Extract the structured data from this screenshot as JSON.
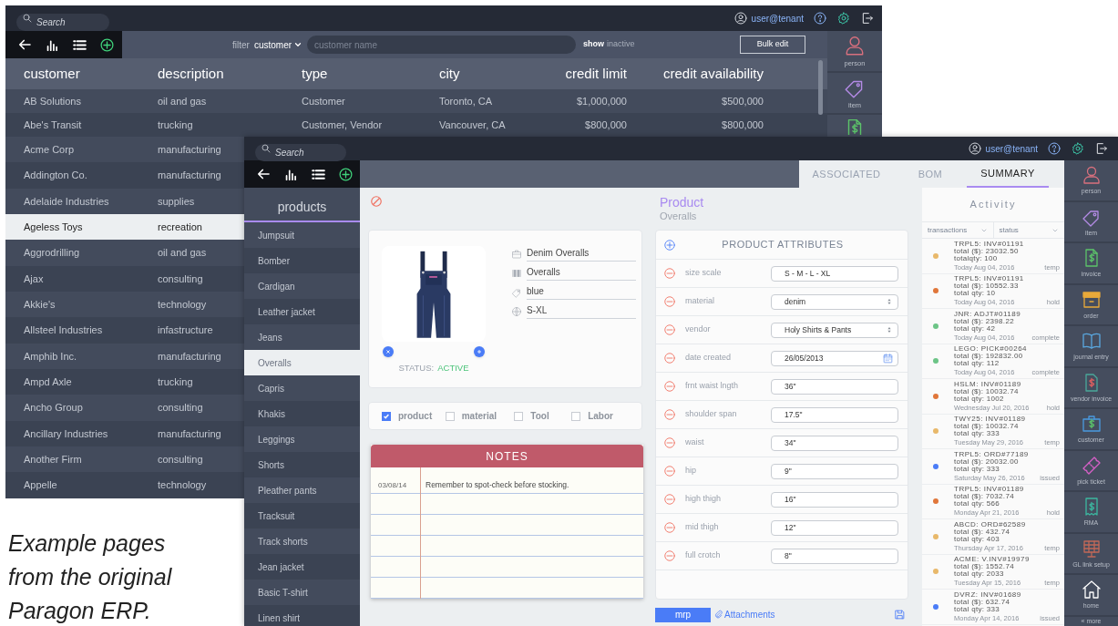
{
  "back_window": {
    "search": {
      "placeholder": "Search"
    },
    "user": "user@tenant",
    "filter": {
      "label": "filter",
      "value": "customer",
      "placeholder": "customer name"
    },
    "show_toggle": {
      "label": "show",
      "value": "inactive"
    },
    "bulk_button": "Bulk edit",
    "table": {
      "columns": [
        "customer",
        "description",
        "type",
        "city",
        "credit limit",
        "credit availability"
      ],
      "rows": [
        {
          "cells": [
            "AB Solutions",
            "oil and gas",
            "Customer",
            "Toronto, CA",
            "$1,000,000",
            "$500,000"
          ],
          "selected": false
        },
        {
          "cells": [
            "Abe's Transit",
            "trucking",
            "Customer, Vendor",
            "Vancouver, CA",
            "$800,000",
            "$800,000"
          ],
          "selected": false
        },
        {
          "cells": [
            "Acme Corp",
            "manufacturing"
          ],
          "selected": false
        },
        {
          "cells": [
            "Addington Co.",
            "manufacturing"
          ],
          "selected": false
        },
        {
          "cells": [
            "Adelaide Industries",
            "supplies"
          ],
          "selected": false
        },
        {
          "cells": [
            "Ageless Toys",
            "recreation"
          ],
          "selected": true
        },
        {
          "cells": [
            "Aggrodrilling",
            "oil and gas"
          ],
          "selected": false
        },
        {
          "cells": [
            "Ajax",
            "consulting"
          ],
          "selected": false
        },
        {
          "cells": [
            "Akkie's",
            "technology"
          ],
          "selected": false
        },
        {
          "cells": [
            "Allsteel Industries",
            "infastructure"
          ],
          "selected": false
        },
        {
          "cells": [
            "Amphib Inc.",
            "manufacturing"
          ],
          "selected": false
        },
        {
          "cells": [
            "Ampd Axle",
            "trucking"
          ],
          "selected": false
        },
        {
          "cells": [
            "Ancho Group",
            "consulting"
          ],
          "selected": false
        },
        {
          "cells": [
            "Ancillary Industries",
            "manufacturing"
          ],
          "selected": false
        },
        {
          "cells": [
            "Another Firm",
            "consulting"
          ],
          "selected": false
        },
        {
          "cells": [
            "Appelle",
            "technology"
          ],
          "selected": false
        }
      ]
    },
    "sidebar": {
      "items": [
        {
          "label": "person"
        },
        {
          "label": "item"
        }
      ]
    }
  },
  "caption": "Example pages from the original Paragon ERP.",
  "front_window": {
    "search": {
      "placeholder": "Search"
    },
    "user": "user@tenant",
    "tabs": [
      {
        "label": "ASSOCIATED",
        "selected": false
      },
      {
        "label": "BOM",
        "selected": false
      },
      {
        "label": "SUMMARY",
        "selected": true
      }
    ],
    "list": {
      "title": "products",
      "items": [
        {
          "label": "Jumpsuit",
          "selected": false
        },
        {
          "label": "Bomber",
          "selected": false
        },
        {
          "label": "Cardigan",
          "selected": false
        },
        {
          "label": "Leather jacket",
          "selected": false
        },
        {
          "label": "Jeans",
          "selected": false
        },
        {
          "label": "Overalls",
          "selected": true
        },
        {
          "label": "Capris",
          "selected": false
        },
        {
          "label": "Khakis",
          "selected": false
        },
        {
          "label": "Leggings",
          "selected": false
        },
        {
          "label": "Shorts",
          "selected": false
        },
        {
          "label": "Pleather pants",
          "selected": false
        },
        {
          "label": "Tracksuit",
          "selected": false
        },
        {
          "label": "Track shorts",
          "selected": false
        },
        {
          "label": "Jean jacket",
          "selected": false
        },
        {
          "label": "Basic T-shirt",
          "selected": false
        },
        {
          "label": "Linen shirt",
          "selected": false
        }
      ]
    },
    "product_card": {
      "fields": [
        "Denim Overalls",
        "Overalls",
        "blue",
        "S-XL"
      ],
      "status_label": "STATUS:",
      "status": "ACTIVE"
    },
    "types": [
      {
        "label": "product",
        "checked": true
      },
      {
        "label": "material",
        "checked": false
      },
      {
        "label": "Tool",
        "checked": false
      },
      {
        "label": "Labor",
        "checked": false
      }
    ],
    "notes": {
      "title": "NOTES",
      "entries": [
        {
          "date": "03/08/14",
          "text": "Remember to spot-check before stocking."
        }
      ]
    },
    "product": {
      "title": "Product",
      "subtitle": "Overalls"
    },
    "attributes": {
      "title": "PRODUCT ATTRIBUTES",
      "rows": [
        {
          "label": "size scale",
          "value": "S - M - L - XL",
          "kind": "text"
        },
        {
          "label": "material",
          "value": "denim",
          "kind": "select"
        },
        {
          "label": "vendor",
          "value": "Holy Shirts & Pants",
          "kind": "select"
        },
        {
          "label": "date created",
          "value": "26/05/2013",
          "kind": "date"
        },
        {
          "label": "frnt waist lngth",
          "value": "36\"",
          "kind": "text"
        },
        {
          "label": "shoulder span",
          "value": "17.5\"",
          "kind": "text"
        },
        {
          "label": "waist",
          "value": "34\"",
          "kind": "text"
        },
        {
          "label": "hip",
          "value": "9\"",
          "kind": "text"
        },
        {
          "label": "high thigh",
          "value": "16\"",
          "kind": "text"
        },
        {
          "label": "mid thigh",
          "value": "12\"",
          "kind": "text"
        },
        {
          "label": "full crotch",
          "value": "8\"",
          "kind": "text"
        }
      ]
    },
    "footer": {
      "mrp_button": "mrp",
      "attachments_link": "Attachments"
    },
    "activity": {
      "title": "Activity",
      "filters": [
        "transactions",
        "status"
      ],
      "entries": [
        {
          "ref": "TRPL5: INV#01191",
          "total": "total ($): 23032.50",
          "qty": "totalqty: 100",
          "date": "Today Aug 04, 2016",
          "status": "temp",
          "color": "#e8b86a"
        },
        {
          "ref": "TRPL5: INV#01191",
          "total": "total ($): 10552.33",
          "qty": "total qty: 10",
          "date": "Today Aug 04, 2016",
          "status": "hold",
          "color": "#e0763a"
        },
        {
          "ref": "JNR: ADJT#01189",
          "total": "total ($): 2398.22",
          "qty": "total qty: 42",
          "date": "Today Aug 04, 2016",
          "status": "complete",
          "color": "#6cc486"
        },
        {
          "ref": "LEGO: PICK#00264",
          "total": "total ($): 192832.00",
          "qty": "total qty: 112",
          "date": "Today Aug 04, 2016",
          "status": "complete",
          "color": "#6cc486"
        },
        {
          "ref": "HSLM: INV#01189",
          "total": "total ($): 10032.74",
          "qty": "total qty: 1002",
          "date": "Wednesday Jul 20, 2016",
          "status": "hold",
          "color": "#e0763a"
        },
        {
          "ref": "TWY25: INV#01189",
          "total": "total ($): 10032.74",
          "qty": "total qty: 333",
          "date": "Tuesday May 29, 2016",
          "status": "temp",
          "color": "#e8b86a"
        },
        {
          "ref": "TRPL5: ORD#77189",
          "total": "total ($): 20032.00",
          "qty": "total qty: 333",
          "date": "Saturday May 26, 2016",
          "status": "issued",
          "color": "#4a7cf7"
        },
        {
          "ref": "TRPL5: INV#01189",
          "total": "total ($): 7032.74",
          "qty": "total qty: 566",
          "date": "Monday Apr 21, 2016",
          "status": "hold",
          "color": "#e0763a"
        },
        {
          "ref": "ABCD: ORD#62589",
          "total": "total ($): 432.74",
          "qty": "total qty: 403",
          "date": "Thursday Apr 17, 2016",
          "status": "temp",
          "color": "#e8b86a"
        },
        {
          "ref": "ACME: V.INV#19979",
          "total": "total ($): 1552.74",
          "qty": "total qty: 2033",
          "date": "Tuesday Apr 15, 2016",
          "status": "temp",
          "color": "#e8b86a"
        },
        {
          "ref": "DVRZ: INV#01689",
          "total": "total ($): 632.74",
          "qty": "total qty: 333",
          "date": "Monday Apr 14, 2016",
          "status": "issued",
          "color": "#4a7cf7"
        }
      ]
    },
    "sidebar": {
      "items": [
        {
          "label": "person"
        },
        {
          "label": "item"
        },
        {
          "label": "invoice"
        },
        {
          "label": "order"
        },
        {
          "label": "journal entry"
        },
        {
          "label": "vendor invoice"
        },
        {
          "label": "customer"
        },
        {
          "label": "pick ticket"
        },
        {
          "label": "RMA"
        },
        {
          "label": "GL link setup"
        },
        {
          "label": "home"
        }
      ],
      "more": "« more"
    }
  }
}
